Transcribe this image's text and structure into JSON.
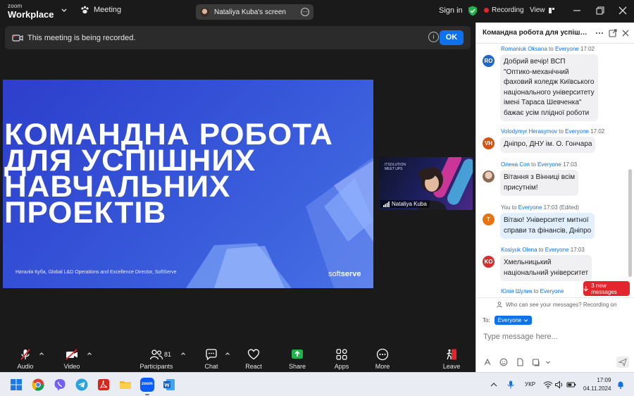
{
  "topbar": {
    "logo_line1": "zoom",
    "logo_line2": "Workplace",
    "meeting_label": "Meeting",
    "screen_share_label": "Nataliya Kuba's screen",
    "signin_label": "Sign in",
    "recording_label": "Recording",
    "view_label": "View"
  },
  "banner": {
    "text": "This meeting is being recorded.",
    "ok_label": "OK"
  },
  "slide": {
    "title": "КОМАНДНА РОБОТА\nДЛЯ УСПІШНИХ\nНАВЧАЛЬНИХ\nПРОЕКТІВ",
    "footer": "Наталія Куба, Global L&D Operations and Excellence Director, SoftServe",
    "brand_a": "soft",
    "brand_b": "serve"
  },
  "speaker": {
    "name": "Nataliya Kuba",
    "background_logo": "ITSOLUTION\nMEET UPS"
  },
  "toolbar": {
    "audio": "Audio",
    "video": "Video",
    "participants": "Participants",
    "participants_count": "81",
    "chat": "Chat",
    "react": "React",
    "share": "Share",
    "apps": "Apps",
    "more": "More",
    "leave": "Leave",
    "share_color": "#21b24b",
    "leave_color": "#e3262d"
  },
  "chat": {
    "title": "Командна робота для успішних навчальних проектів",
    "messages": [
      {
        "sender": "Romaniuk Oksana",
        "to": "Everyone",
        "time": "17:02",
        "initials": "RO",
        "avatar_color": "#1f67c8",
        "text": "Добрий вечір! ВСП\n\"Оптико-механічний\nфаховий коледж Київського\nнаціонального університету\nімені Тараса Шевченка\"\nбажає усім плідної роботи"
      },
      {
        "sender": "Volodymyr Herasymov",
        "to": "Everyone",
        "time": "17:02",
        "initials": "VH",
        "avatar_color": "#d4540f",
        "text": "Дніпро, ДНУ ім. О. Гончара"
      },
      {
        "sender": "Олена Соя",
        "to": "Everyone",
        "time": "17:03",
        "initials": "",
        "avatar_color": "#c7a28c",
        "text": "Вітання з Вінниці всім\nприсутнім!"
      },
      {
        "sender": "You",
        "to": "Everyone",
        "time": "17:03",
        "edited": "(Edited)",
        "initials": "T",
        "avatar_color": "#e8740f",
        "text": "Вітаю! Університет митної\nсправи та фінансів, Дніпро"
      },
      {
        "sender": "Kosiyuk Olena",
        "to": "Everyone",
        "time": "17:03",
        "initials": "KO",
        "avatar_color": "#d62f2f",
        "text": "Хмельницький\nнаціональний університет"
      },
      {
        "sender": "Юлія Шулик",
        "to": "Everyone",
        "time": "",
        "initials": "",
        "avatar_color": "#999999",
        "text": ""
      }
    ],
    "to_word": "to",
    "new_messages": "3 new messages",
    "who_can_see": "Who can see your messages? Recording on",
    "to_label": "To:",
    "to_value": "Everyone",
    "input_placeholder": "Type message here..."
  },
  "taskbar": {
    "language": "УКР",
    "time": "17:09",
    "date": "04.11.2024"
  }
}
